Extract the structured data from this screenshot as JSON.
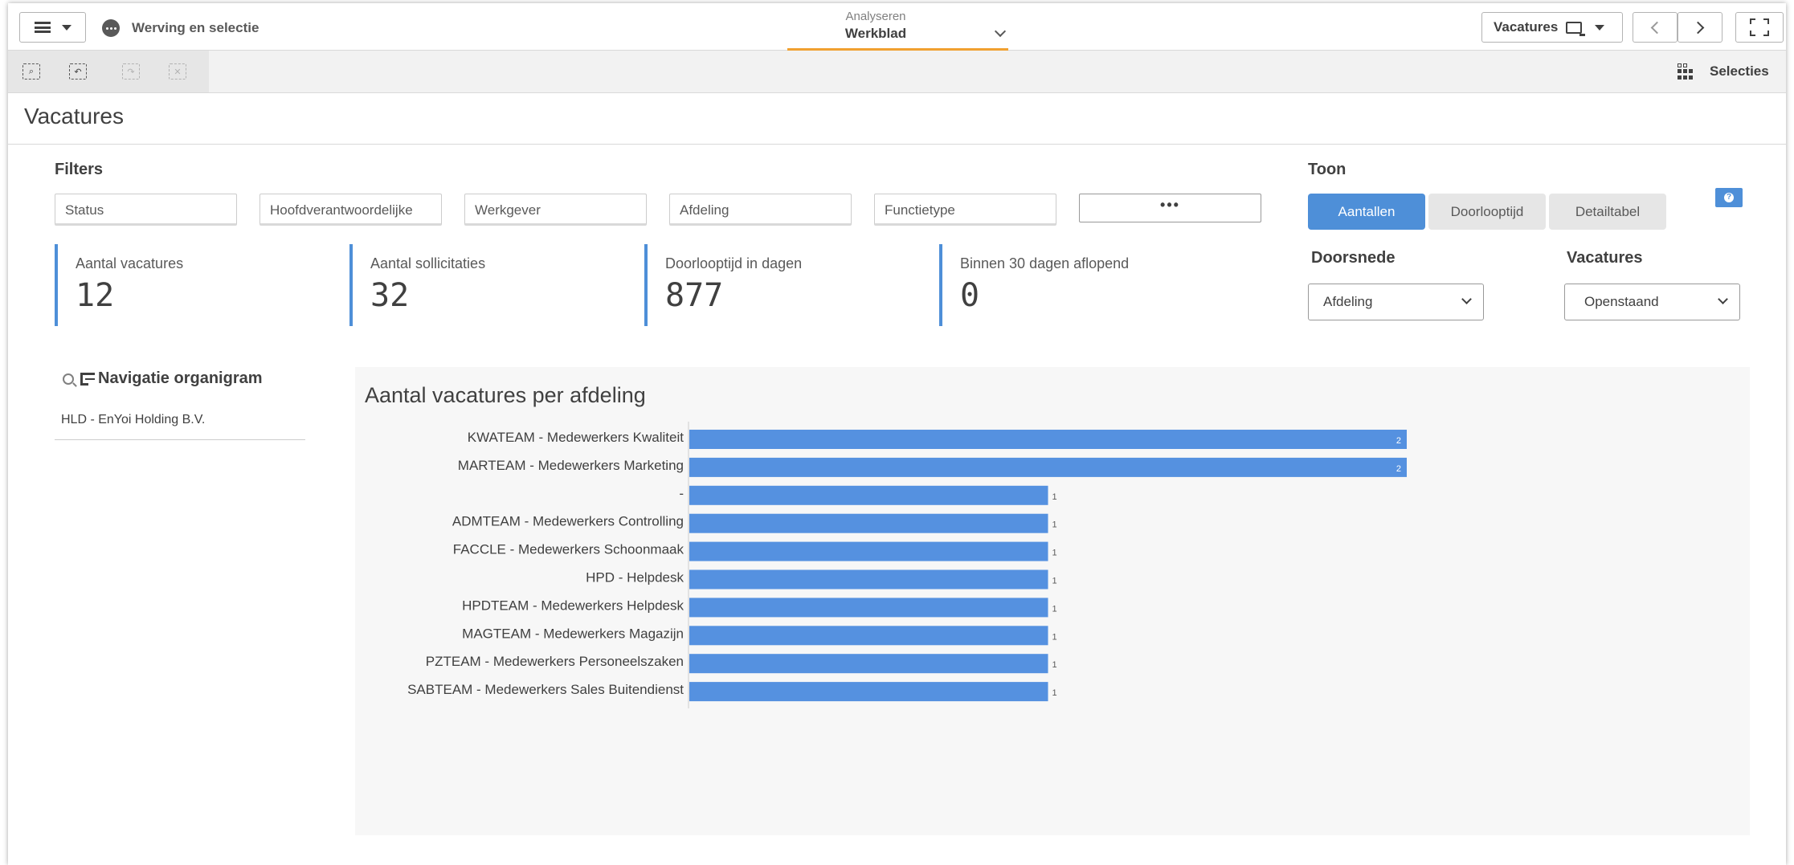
{
  "topbar": {
    "app_title": "Werving en selectie",
    "mode_sub": "Analyseren",
    "mode_main": "Werkblad",
    "sheet_button_label": "Vacatures"
  },
  "toolbar": {
    "selections_label": "Selecties"
  },
  "sheet": {
    "title": "Vacatures"
  },
  "filters": {
    "label": "Filters",
    "items": [
      "Status",
      "Hoofdverantwoordelijke",
      "Werkgever",
      "Afdeling",
      "Functietype"
    ],
    "more_label": "•••"
  },
  "kpis": [
    {
      "label": "Aantal vacatures",
      "value": "12"
    },
    {
      "label": "Aantal sollicitaties",
      "value": "32"
    },
    {
      "label": "Doorlooptijd in dagen",
      "value": "877"
    },
    {
      "label": "Binnen 30 dagen aflopend",
      "value": "0"
    }
  ],
  "toon": {
    "label": "Toon",
    "buttons": [
      "Aantallen",
      "Doorlooptijd",
      "Detailtabel"
    ],
    "active": "Aantallen"
  },
  "doorsnede": {
    "label": "Doorsnede",
    "selected": "Afdeling"
  },
  "vacatures_select": {
    "label": "Vacatures",
    "selected": "Openstaand"
  },
  "navigation": {
    "title": "Navigatie organigram",
    "items": [
      "HLD - EnYoi Holding B.V."
    ]
  },
  "colors": {
    "accent": "#4e8fd8",
    "mode_underline": "#f0a030"
  },
  "chart_data": {
    "type": "bar",
    "orientation": "horizontal",
    "title": "Aantal vacatures per afdeling",
    "categories": [
      "KWATEAM - Medewerkers Kwaliteit",
      "MARTEAM - Medewerkers Marketing",
      "-",
      "ADMTEAM - Medewerkers Controlling",
      "FACCLE - Medewerkers Schoonmaak",
      "HPD - Helpdesk",
      "HPDTEAM - Medewerkers Helpdesk",
      "MAGTEAM - Medewerkers Magazijn",
      "PZTEAM - Medewerkers Personeelszaken",
      "SABTEAM - Medewerkers Sales Buitendienst"
    ],
    "values": [
      2,
      2,
      1,
      1,
      1,
      1,
      1,
      1,
      1,
      1
    ],
    "xlim": [
      0,
      2
    ],
    "color": "#5591e0",
    "grid": false
  }
}
